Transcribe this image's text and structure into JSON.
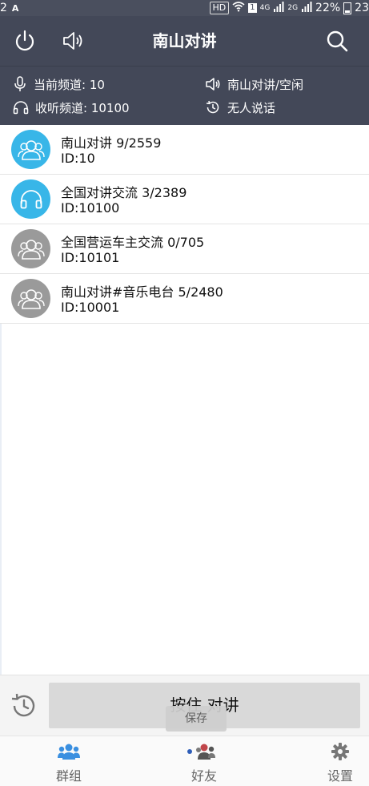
{
  "status_bar": {
    "left_text": "2",
    "left_badge": "A",
    "hd": "HD",
    "sim": "1",
    "network": "4G",
    "sim2": "2G",
    "battery": "22%",
    "time": "23"
  },
  "app_bar": {
    "title": "南山对讲",
    "icons": [
      "power-icon",
      "speaker-icon",
      "search-icon"
    ]
  },
  "info": {
    "current_channel": "当前频道: 10",
    "listen_channel": "收听频道: 10100",
    "channel_status": "南山对讲/空闲",
    "speaker_status": "无人说话"
  },
  "channels": [
    {
      "name": "南山对讲 9/2559",
      "id": "ID:10",
      "avatar": "group-icon",
      "color": "#38b6e8"
    },
    {
      "name": "全国对讲交流 3/2389",
      "id": "ID:10100",
      "avatar": "headphones-icon",
      "color": "#38b6e8"
    },
    {
      "name": "全国营运车主交流 0/705",
      "id": "ID:10101",
      "avatar": "group-icon",
      "color": "#9a9a9a"
    },
    {
      "name": "南山对讲#音乐电台 5/2480",
      "id": "ID:10001",
      "avatar": "group-icon",
      "color": "#9a9a9a"
    }
  ],
  "ptt": {
    "label": "按住 对讲",
    "toast": "保存"
  },
  "nav": {
    "items": [
      {
        "label": "群组",
        "icon": "groups-icon",
        "active": true
      },
      {
        "label": "好友",
        "icon": "friends-icon",
        "active": false
      },
      {
        "label": "设置",
        "icon": "settings-icon",
        "active": false
      }
    ]
  },
  "colors": {
    "header_bg": "#434858",
    "accent_blue": "#38b6e8",
    "inactive_gray": "#9a9a9a"
  }
}
